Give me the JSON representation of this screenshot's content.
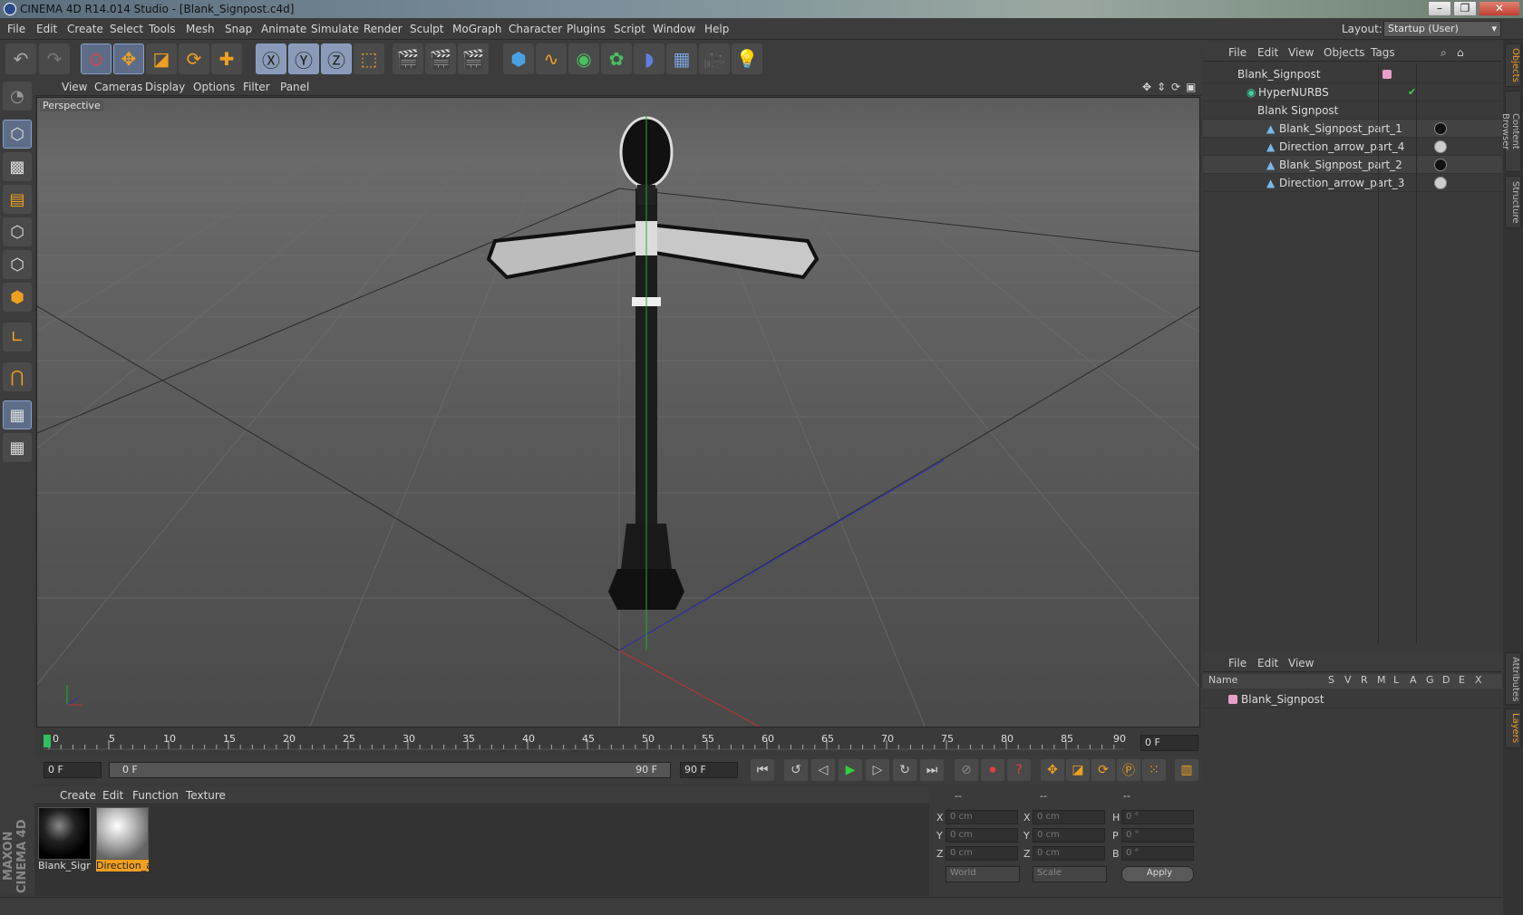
{
  "window": {
    "title": "CINEMA 4D R14.014 Studio - [Blank_Signpost.c4d]",
    "min": "–",
    "max": "❐",
    "close": "✕"
  },
  "menu": [
    "File",
    "Edit",
    "Create",
    "Select",
    "Tools",
    "Mesh",
    "Snap",
    "Animate",
    "Simulate",
    "Render",
    "Sculpt",
    "MoGraph",
    "Character",
    "Plugins",
    "Script",
    "Window",
    "Help"
  ],
  "layout": {
    "label": "Layout:",
    "value": "Startup (User)"
  },
  "viewport": {
    "menu": [
      "View",
      "Cameras",
      "Display",
      "Options",
      "Filter",
      "Panel"
    ],
    "label": "Perspective"
  },
  "timeline": {
    "ticks": [
      "0",
      "5",
      "10",
      "15",
      "20",
      "25",
      "30",
      "35",
      "40",
      "45",
      "50",
      "55",
      "60",
      "65",
      "70",
      "75",
      "80",
      "85",
      "90"
    ],
    "current_frame": "0 F"
  },
  "transport": {
    "start": "0 F",
    "range_start": "0 F",
    "range_end": "90 F",
    "end": "90 F"
  },
  "materials": {
    "menu": [
      "Create",
      "Edit",
      "Function",
      "Texture"
    ],
    "items": [
      {
        "name": "Blank_Sign",
        "selected": false
      },
      {
        "name": "Direction_a",
        "selected": true
      }
    ]
  },
  "coords": {
    "headers": [
      "--",
      "--",
      "--"
    ],
    "rows": [
      {
        "a": "X",
        "v1": "0 cm",
        "b": "X",
        "v2": "0 cm",
        "c": "H",
        "v3": "0 °"
      },
      {
        "a": "Y",
        "v1": "0 cm",
        "b": "Y",
        "v2": "0 cm",
        "c": "P",
        "v3": "0 °"
      },
      {
        "a": "Z",
        "v1": "0 cm",
        "b": "Z",
        "v2": "0 cm",
        "c": "B",
        "v3": "0 °"
      }
    ],
    "space": "World",
    "mode": "Scale",
    "apply": "Apply"
  },
  "objects": {
    "menu": [
      "File",
      "Edit",
      "View",
      "Objects",
      "Tags"
    ],
    "rows": [
      {
        "name": "Blank_Signpost",
        "indent": 0
      },
      {
        "name": "HyperNURBS",
        "indent": 1
      },
      {
        "name": "Blank Signpost",
        "indent": 2
      },
      {
        "name": "Blank_Signpost_part_1",
        "indent": 3
      },
      {
        "name": "Direction_arrow_part_4",
        "indent": 3
      },
      {
        "name": "Blank_Signpost_part_2",
        "indent": 3
      },
      {
        "name": "Direction_arrow_part_3",
        "indent": 3
      }
    ]
  },
  "layers": {
    "menu": [
      "File",
      "Edit",
      "View"
    ],
    "columns": [
      "Name",
      "S",
      "V",
      "R",
      "M",
      "L",
      "A",
      "G",
      "D",
      "E",
      "X"
    ],
    "rows": [
      {
        "name": "Blank_Signpost"
      }
    ]
  },
  "right_tabs": [
    "Objects",
    "Content Browser",
    "Structure",
    "Attributes",
    "Layers"
  ],
  "brand": "MAXON CINEMA 4D",
  "colors": {
    "accent": "#f0a020",
    "selected_tool": "#5d6d88",
    "layer_color": "#e8a0c8"
  }
}
